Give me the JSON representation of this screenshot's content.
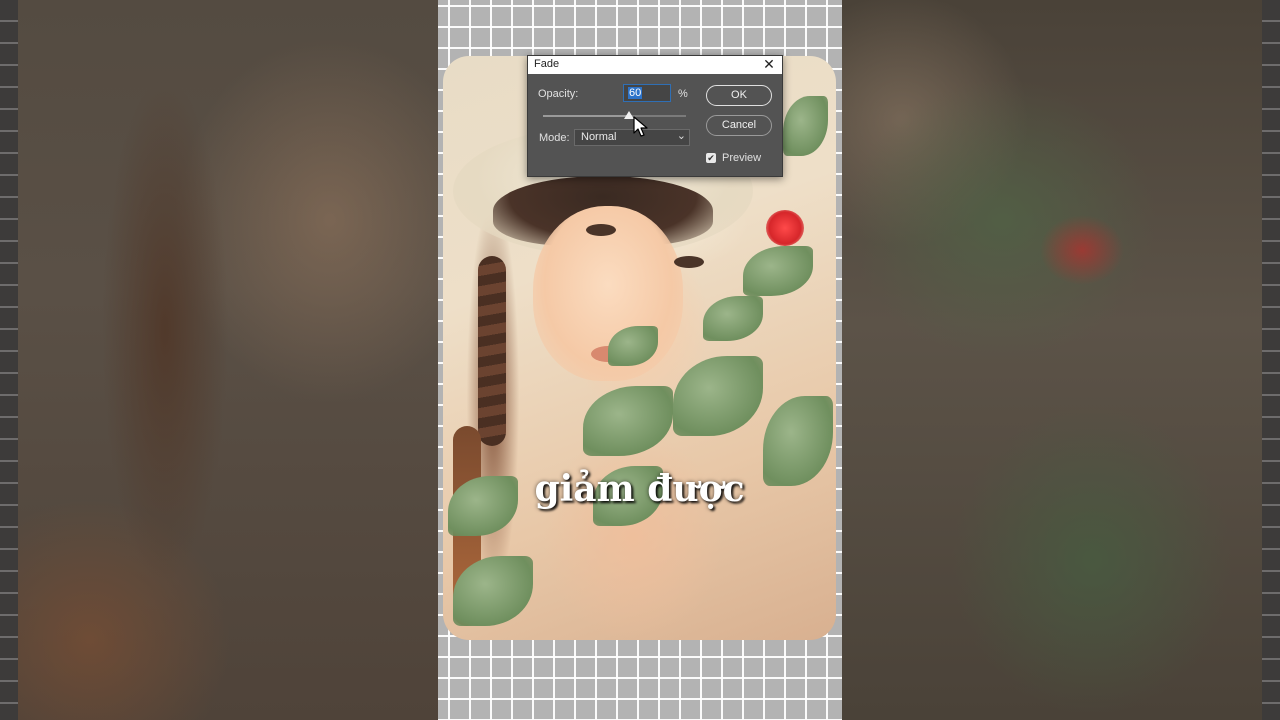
{
  "dialog": {
    "title": "Fade",
    "opacity_label": "Opacity:",
    "opacity_value": "60",
    "opacity_unit": "%",
    "opacity_slider_fraction": 0.6,
    "mode_label": "Mode:",
    "mode_value": "Normal",
    "ok_label": "OK",
    "cancel_label": "Cancel",
    "preview_label": "Preview",
    "preview_checked": true,
    "close_icon": "close-icon"
  },
  "caption": {
    "text": "giảm được"
  },
  "colors": {
    "dialog_bg": "#535353",
    "selection_highlight": "#2d73c9",
    "grid_bg": "#b3b3b3",
    "caption_text": "#ffffff"
  }
}
